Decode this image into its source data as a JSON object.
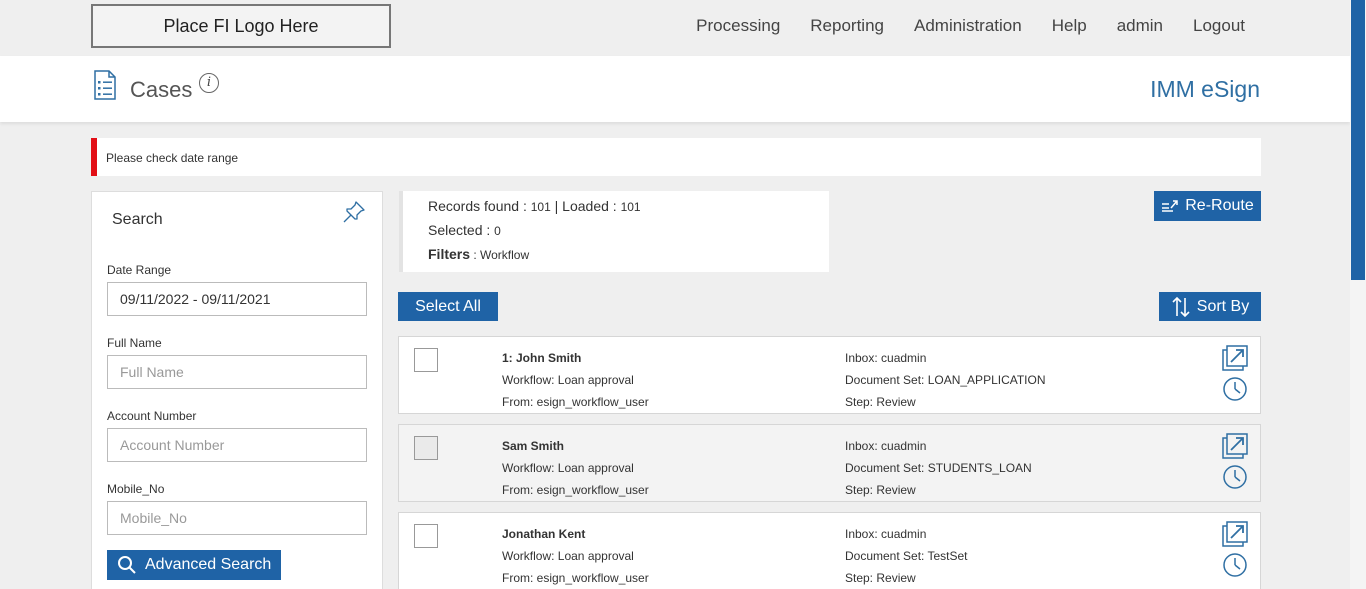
{
  "logo": {
    "text": "Place FI Logo Here"
  },
  "nav": {
    "items": [
      "Processing",
      "Reporting",
      "Administration",
      "Help",
      "admin",
      "Logout"
    ]
  },
  "header": {
    "title": "Cases",
    "brand": "IMM eSign",
    "info_glyph": "i"
  },
  "alert": {
    "message": "Please check date range"
  },
  "search": {
    "title": "Search",
    "date_range_label": "Date Range",
    "date_range_value": "09/11/2022 - 09/11/2021",
    "full_name_label": "Full Name",
    "full_name_placeholder": "Full Name",
    "account_number_label": "Account Number",
    "account_number_placeholder": "Account Number",
    "mobile_label": "Mobile_No",
    "mobile_placeholder": "Mobile_No",
    "advanced_search_label": "Advanced Search"
  },
  "records": {
    "found_label": "Records found : ",
    "found_value": "101",
    "loaded_label": " | Loaded : ",
    "loaded_value": "101",
    "selected_label": "Selected : ",
    "selected_value": "0",
    "filters_label": "Filters",
    "filters_value": " : Workflow"
  },
  "actions": {
    "reroute_label": "Re-Route",
    "select_all_label": "Select All",
    "sort_by_label": "Sort By"
  },
  "colors": {
    "primary": "#1f63a6",
    "alert": "#e20f16",
    "brand": "#2f6fa3"
  },
  "cases": [
    {
      "name": "1: John Smith",
      "workflow": "Workflow: Loan approval",
      "from": "From: esign_workflow_user",
      "inbox": "Inbox: cuadmin",
      "document_set": "Document Set: LOAN_APPLICATION",
      "step": "Step: Review"
    },
    {
      "name": "Sam Smith",
      "workflow": "Workflow: Loan approval",
      "from": "From: esign_workflow_user",
      "inbox": "Inbox: cuadmin",
      "document_set": "Document Set: STUDENTS_LOAN",
      "step": "Step: Review"
    },
    {
      "name": "Jonathan Kent",
      "workflow": "Workflow: Loan approval",
      "from": "From: esign_workflow_user",
      "inbox": "Inbox: cuadmin",
      "document_set": "Document Set: TestSet",
      "step": "Step: Review"
    }
  ]
}
